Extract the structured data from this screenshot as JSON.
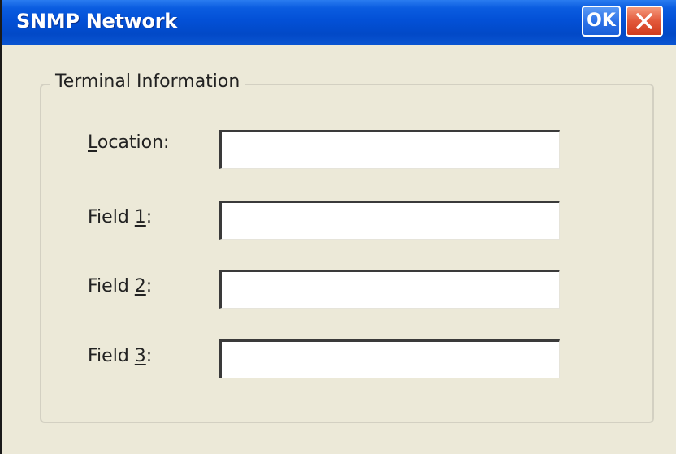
{
  "window": {
    "title": "SNMP Network",
    "ok_label": "OK"
  },
  "group": {
    "title": "Terminal Information"
  },
  "fields": [
    {
      "label_before": "",
      "mnemonic": "L",
      "label_after": "ocation:",
      "value": ""
    },
    {
      "label_before": "Field ",
      "mnemonic": "1",
      "label_after": ":",
      "value": ""
    },
    {
      "label_before": "Field ",
      "mnemonic": "2",
      "label_after": ":",
      "value": ""
    },
    {
      "label_before": "Field ",
      "mnemonic": "3",
      "label_after": ":",
      "value": ""
    }
  ],
  "icons": {
    "close": "close-icon"
  },
  "colors": {
    "titlebar": "#0350d6",
    "face": "#ece9d8",
    "close": "#e2583a"
  }
}
